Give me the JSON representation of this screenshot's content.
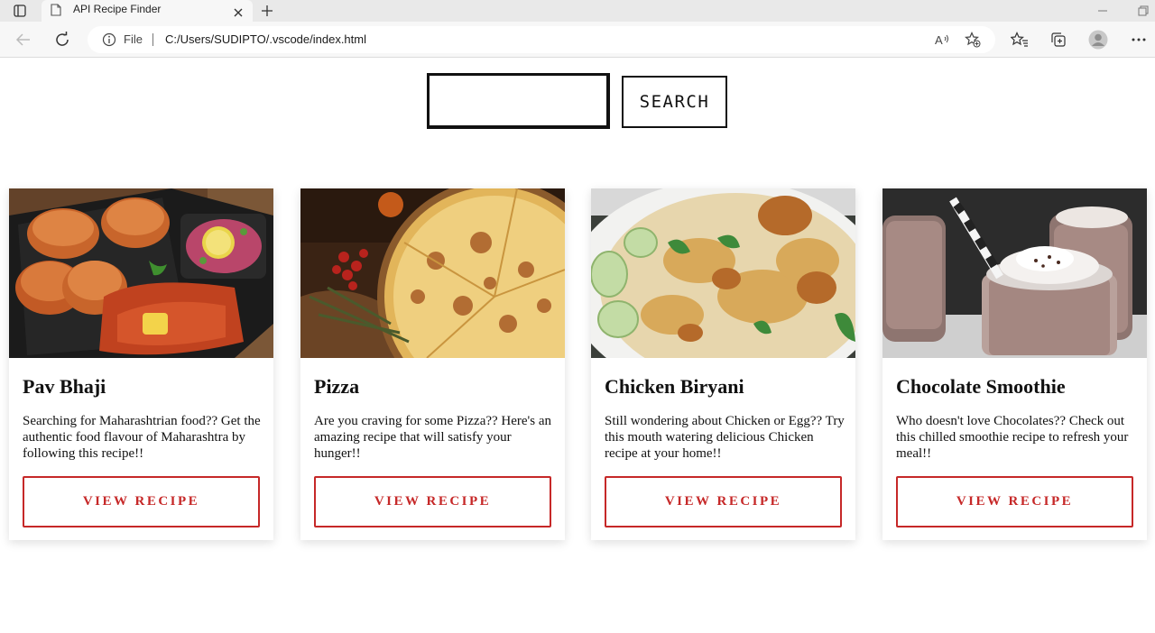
{
  "browser": {
    "tab_title": "API Recipe Finder",
    "address_scheme": "File",
    "url": "C:/Users/SUDIPTO/.vscode/index.html",
    "icons": [
      "sidebar-icon",
      "page-icon",
      "close-icon",
      "new-tab-icon",
      "minimize-icon",
      "restore-icon",
      "back-icon",
      "refresh-icon",
      "info-icon",
      "read-aloud-icon",
      "add-favorite-icon",
      "favorites-icon",
      "collections-icon",
      "profile-icon",
      "more-icon"
    ]
  },
  "search": {
    "input_value": "",
    "button_label": "SEARCH"
  },
  "cards": [
    {
      "title": "Pav Bhaji",
      "description": "Searching for Maharashtrian food?? Get the authentic food flavour of Maharashtra by following this recipe!!",
      "button_label": "VIEW RECIPE"
    },
    {
      "title": "Pizza",
      "description": "Are you craving for some Pizza?? Here's an amazing recipe that will satisfy your hunger!!",
      "button_label": "VIEW RECIPE"
    },
    {
      "title": "Chicken Biryani",
      "description": "Still wondering about Chicken or Egg?? Try this mouth watering delicious Chicken recipe at your home!!",
      "button_label": "VIEW RECIPE"
    },
    {
      "title": "Chocolate Smoothie",
      "description": "Who doesn't love Chocolates?? Check out this chilled smoothie recipe to refresh your meal!!",
      "button_label": "VIEW RECIPE"
    }
  ],
  "colors": {
    "accent": "#c62828",
    "text": "#111111",
    "chrome": "#f7f7f7"
  }
}
